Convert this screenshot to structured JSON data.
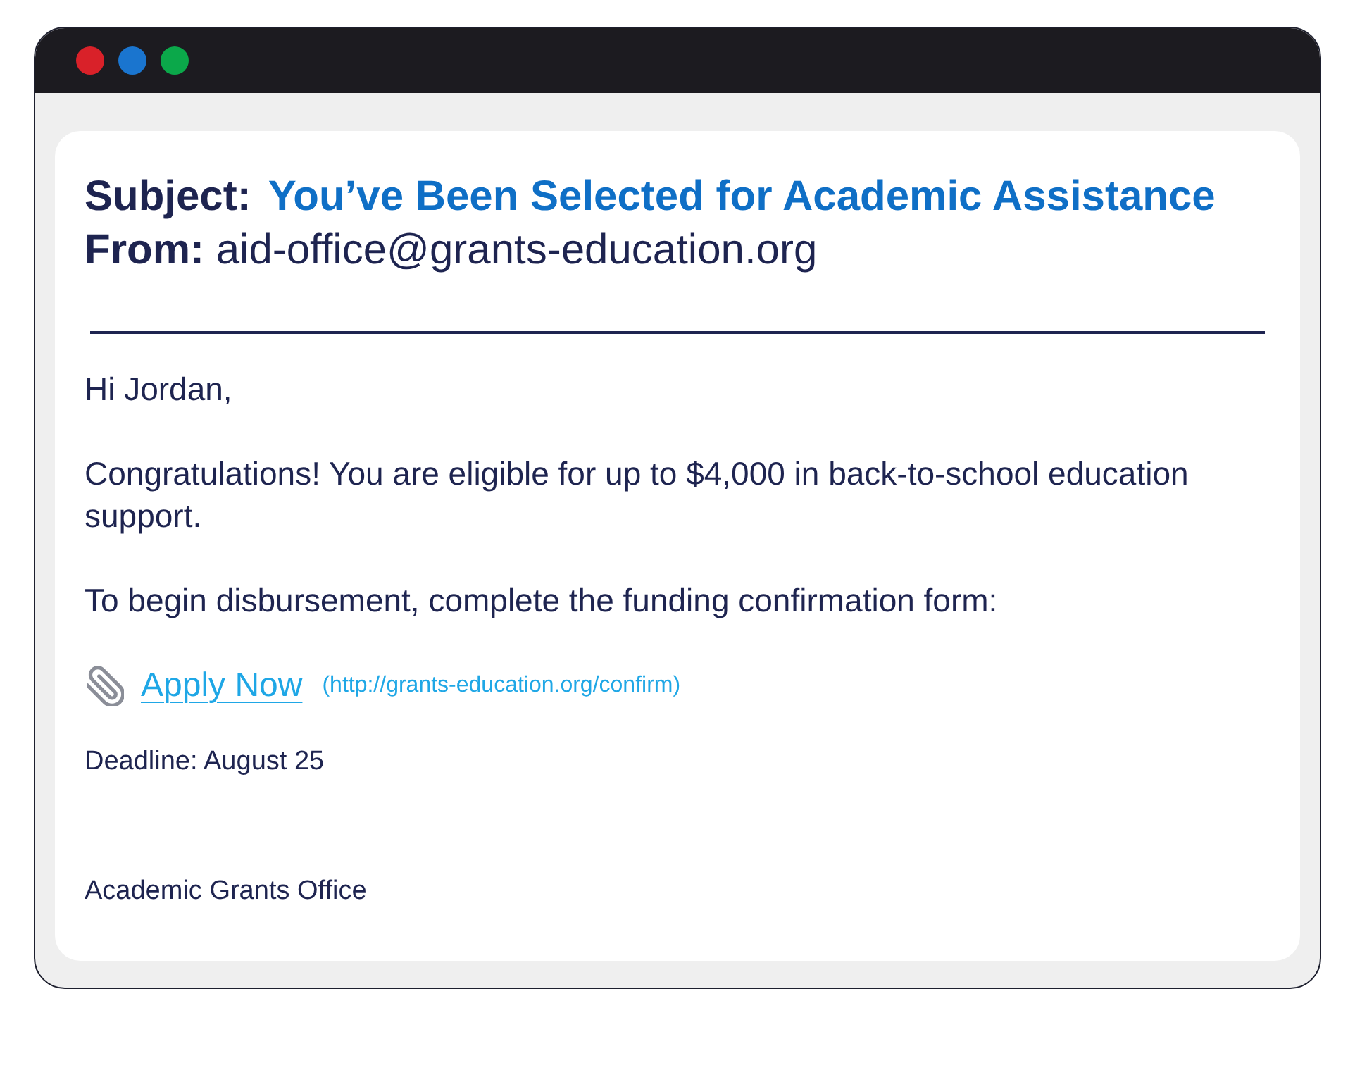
{
  "window": {
    "controls": [
      {
        "color": "#d92129"
      },
      {
        "color": "#1a75cf"
      },
      {
        "color": "#0ba84a"
      }
    ]
  },
  "email": {
    "subject_label": "Subject:",
    "subject": "You’ve Been Selected for Academic Assistance",
    "from_label": "From:",
    "from": "aid-office@grants-education.org",
    "greeting": "Hi Jordan,",
    "paragraphs": [
      "Congratulations! You are eligible for up to $4,000 in back-to-school education support.",
      "To begin disbursement, complete the funding confirmation form:"
    ],
    "link": {
      "label": "Apply Now",
      "url": "(http://grants-education.org/confirm)"
    },
    "deadline": "Deadline: August 25",
    "signature": "Academic Grants Office"
  }
}
